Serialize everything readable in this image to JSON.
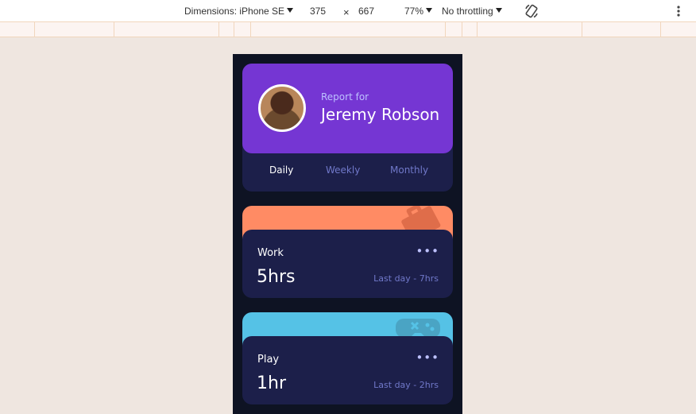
{
  "devtools": {
    "dimensions_label": "Dimensions: iPhone SE",
    "width": "375",
    "times": "×",
    "height": "667",
    "zoom": "77%",
    "throttling": "No throttling",
    "rotate_icon": "rotate-icon",
    "more_icon": "kebab-menu-icon"
  },
  "profile": {
    "report_for": "Report for",
    "name": "Jeremy Robson",
    "tabs": [
      "Daily",
      "Weekly",
      "Monthly"
    ],
    "active_tab": "Daily"
  },
  "cards": [
    {
      "title": "Work",
      "hours": "5hrs",
      "previous": "Last day - 7hrs",
      "more": "•••",
      "color": "#ff8b64",
      "icon": "briefcase-icon"
    },
    {
      "title": "Play",
      "hours": "1hr",
      "previous": "Last day - 2hrs",
      "more": "•••",
      "color": "#55c2e6",
      "icon": "gamepad-icon"
    }
  ],
  "colors": {
    "page_bg": "#0e1323",
    "card_bg": "#1c1f4a",
    "profile_bg": "#7536d3",
    "muted_text": "#7078c9",
    "pale_text": "#bdc1ff"
  }
}
